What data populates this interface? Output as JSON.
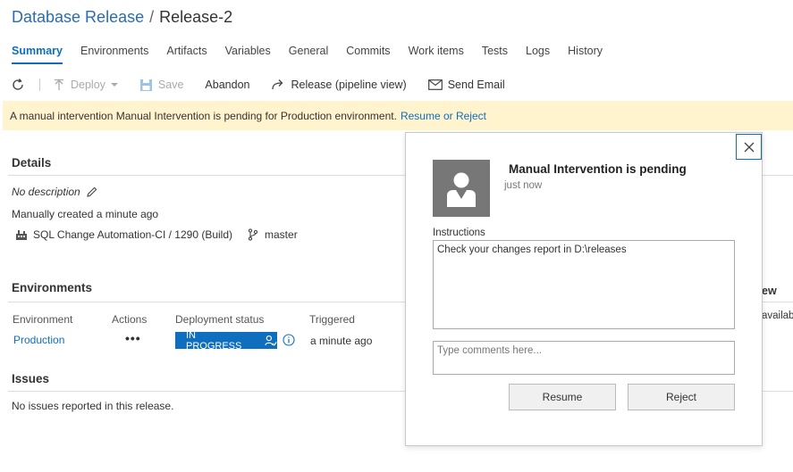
{
  "breadcrumb": {
    "parent": "Database Release",
    "separator": "/",
    "current": "Release-2"
  },
  "tabs": [
    {
      "label": "Summary",
      "active": true
    },
    {
      "label": "Environments"
    },
    {
      "label": "Artifacts"
    },
    {
      "label": "Variables"
    },
    {
      "label": "General"
    },
    {
      "label": "Commits"
    },
    {
      "label": "Work items"
    },
    {
      "label": "Tests"
    },
    {
      "label": "Logs"
    },
    {
      "label": "History"
    }
  ],
  "toolbar": {
    "deploy": "Deploy",
    "save": "Save",
    "abandon": "Abandon",
    "release_pipeline": "Release (pipeline view)",
    "send_email": "Send Email"
  },
  "banner": {
    "text": "A manual intervention Manual Intervention is pending for Production environment.",
    "link": "Resume or Reject"
  },
  "details": {
    "title": "Details",
    "description": "No description",
    "created": "Manually created a minute ago",
    "build": "SQL Change Automation-CI / 1290 (Build)",
    "branch": "master"
  },
  "environments": {
    "title": "Environments",
    "headers": {
      "environment": "Environment",
      "actions": "Actions",
      "status": "Deployment status",
      "triggered": "Triggered"
    },
    "rows": [
      {
        "name": "Production",
        "actions": "•••",
        "status": "IN PROGRESS",
        "triggered": "a minute ago"
      }
    ]
  },
  "issues": {
    "title": "Issues",
    "text": "No issues reported in this release."
  },
  "peek": {
    "heading_tail": "ew",
    "text_tail": "availab"
  },
  "dialog": {
    "title": "Manual Intervention is pending",
    "time": "just now",
    "instructions_label": "Instructions",
    "instructions": "Check your changes report in D:\\releases",
    "comment_placeholder": "Type comments here...",
    "resume": "Resume",
    "reject": "Reject"
  },
  "colors": {
    "accent": "#106ebe",
    "banner_bg": "#fff4ce",
    "avatar_bg": "#777777"
  }
}
